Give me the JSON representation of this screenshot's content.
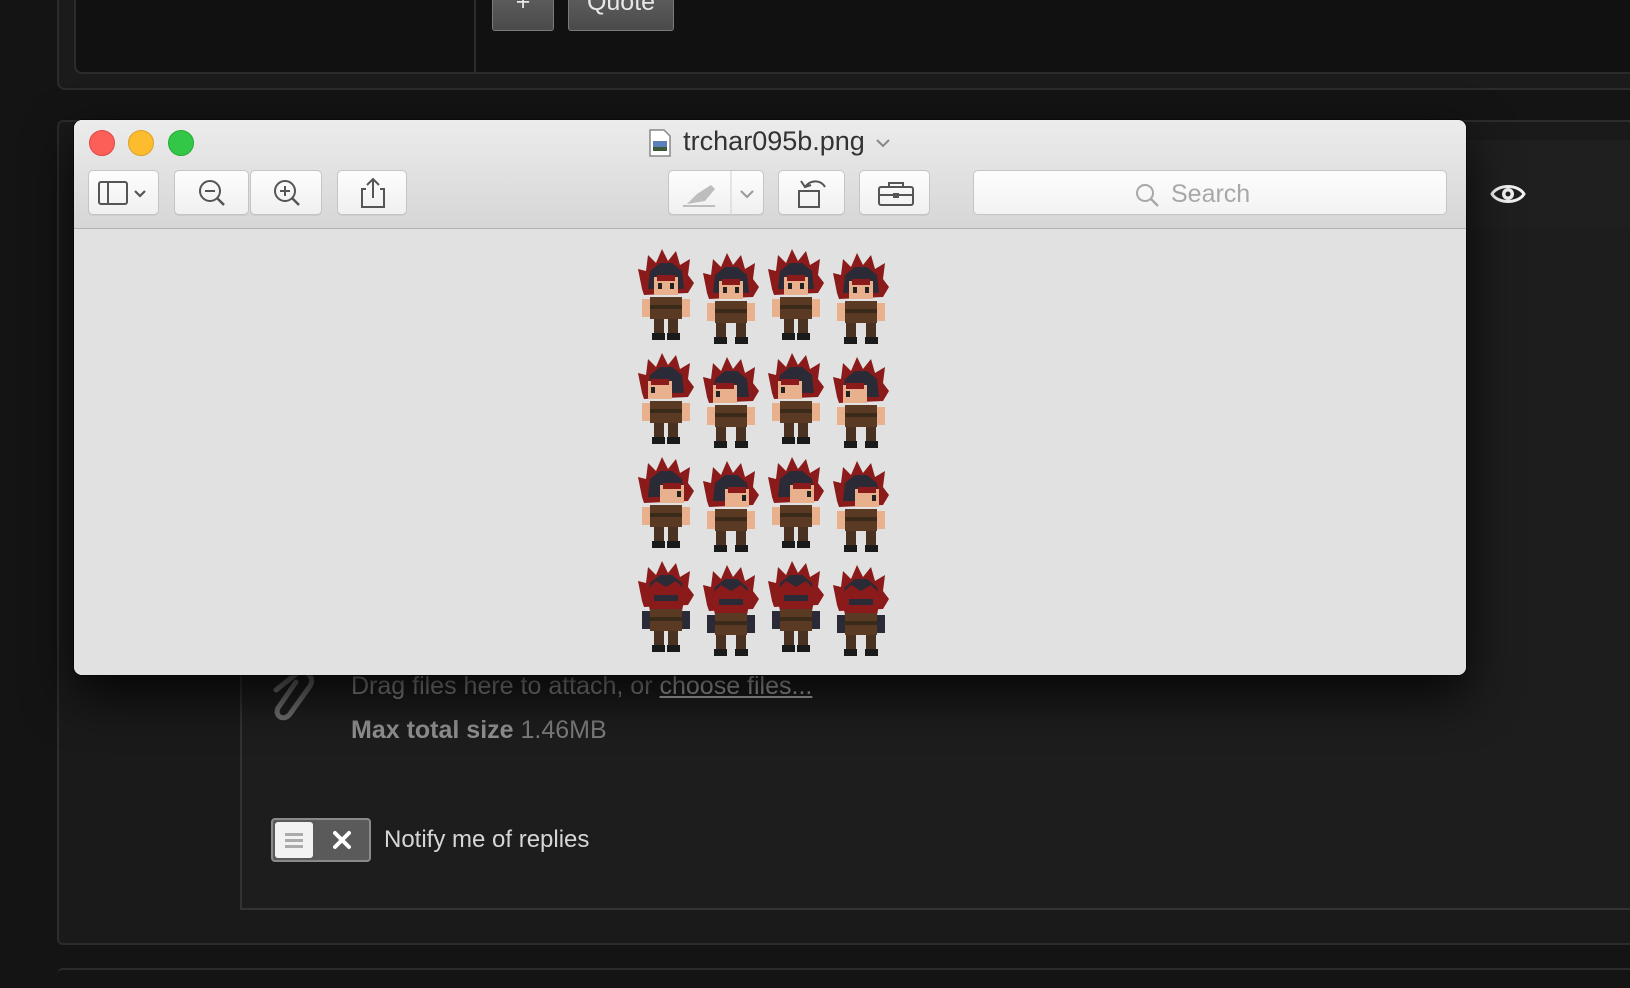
{
  "forum": {
    "add_button": "+",
    "quote_button": "Quote",
    "attach_text": "Drag files here to attach, or",
    "attach_link": "choose files...",
    "max_size_label": "Max total size",
    "max_size_value": "1.46MB",
    "notify_label": "Notify me of replies"
  },
  "preview": {
    "file_name": "trchar095b.png",
    "search_placeholder": "Search",
    "toolbar": {
      "sidebar": "sidebar-icon",
      "zoom_out": "zoom-out-icon",
      "zoom_in": "zoom-in-icon",
      "share": "share-icon",
      "markup": "pen-icon",
      "rotate": "rotate-icon",
      "toolbox": "toolbox-icon"
    },
    "sprite_sheet": {
      "rows": [
        "front",
        "left",
        "right",
        "back"
      ],
      "columns": 4,
      "colors": {
        "hair": "#8b1a1a",
        "hair_dark": "#2a2b36",
        "skin": "#e8b08c",
        "clothes": "#5a3a22",
        "boots": "#1a1a1a"
      }
    }
  },
  "colors": {
    "forum_bg": "#141414",
    "window_bg": "#e1e1e1",
    "close": "#fc5f57",
    "minimize": "#fdbc2e",
    "zoom": "#33c748"
  }
}
